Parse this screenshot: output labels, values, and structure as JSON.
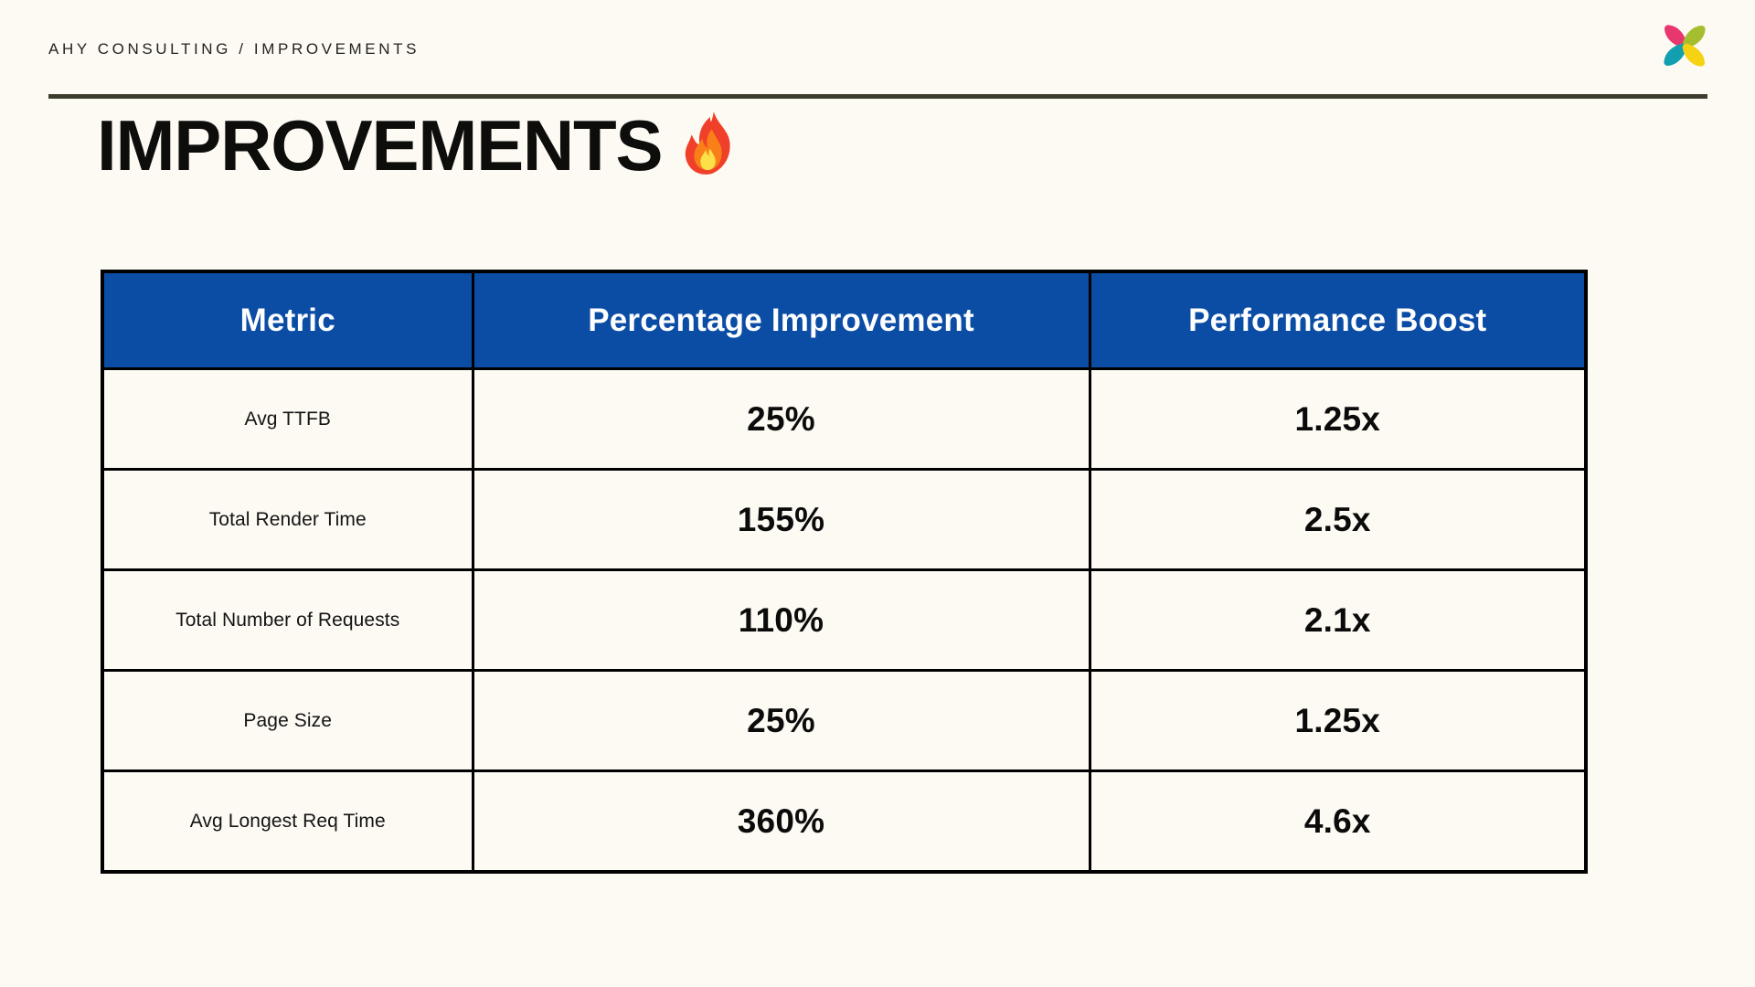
{
  "slide": {
    "background_color": "#FDF9F3",
    "eyebrow": "AHY CONSULTING / IMPROVEMENTS",
    "title": "IMPROVEMENTS",
    "title_emoji_name": "fire-emoji",
    "rule_color": "#3C3D2D"
  },
  "logo": {
    "name": "ahy-consulting-logo",
    "petal_colors": {
      "top_left": "#E8366F",
      "top_right": "#A5BE30",
      "bottom_left": "#12A0B0",
      "bottom_right": "#F5D312"
    }
  },
  "table": {
    "header_background": "#0B4DA5",
    "header_text_color": "#FFFFFF",
    "border_color": "#000000",
    "columns": [
      "Metric",
      "Percentage Improvement",
      "Performance Boost"
    ],
    "rows": [
      {
        "metric": "Avg TTFB",
        "percentage_improvement": "25%",
        "performance_boost": "1.25x"
      },
      {
        "metric": "Total Render Time",
        "percentage_improvement": "155%",
        "performance_boost": "2.5x"
      },
      {
        "metric": "Total Number of Requests",
        "percentage_improvement": "110%",
        "performance_boost": "2.1x"
      },
      {
        "metric": "Page Size",
        "percentage_improvement": "25%",
        "performance_boost": "1.25x"
      },
      {
        "metric": "Avg Longest Req Time",
        "percentage_improvement": "360%",
        "performance_boost": "4.6x"
      }
    ]
  },
  "chart_data": {
    "type": "table",
    "title": "IMPROVEMENTS",
    "categories": [
      "Avg TTFB",
      "Total Render Time",
      "Total Number of Requests",
      "Page Size",
      "Avg Longest Req Time"
    ],
    "series": [
      {
        "name": "Percentage Improvement",
        "values": [
          25,
          155,
          110,
          25,
          360
        ],
        "unit": "%"
      },
      {
        "name": "Performance Boost",
        "values": [
          1.25,
          2.5,
          2.1,
          1.25,
          4.6
        ],
        "unit": "x"
      }
    ]
  }
}
